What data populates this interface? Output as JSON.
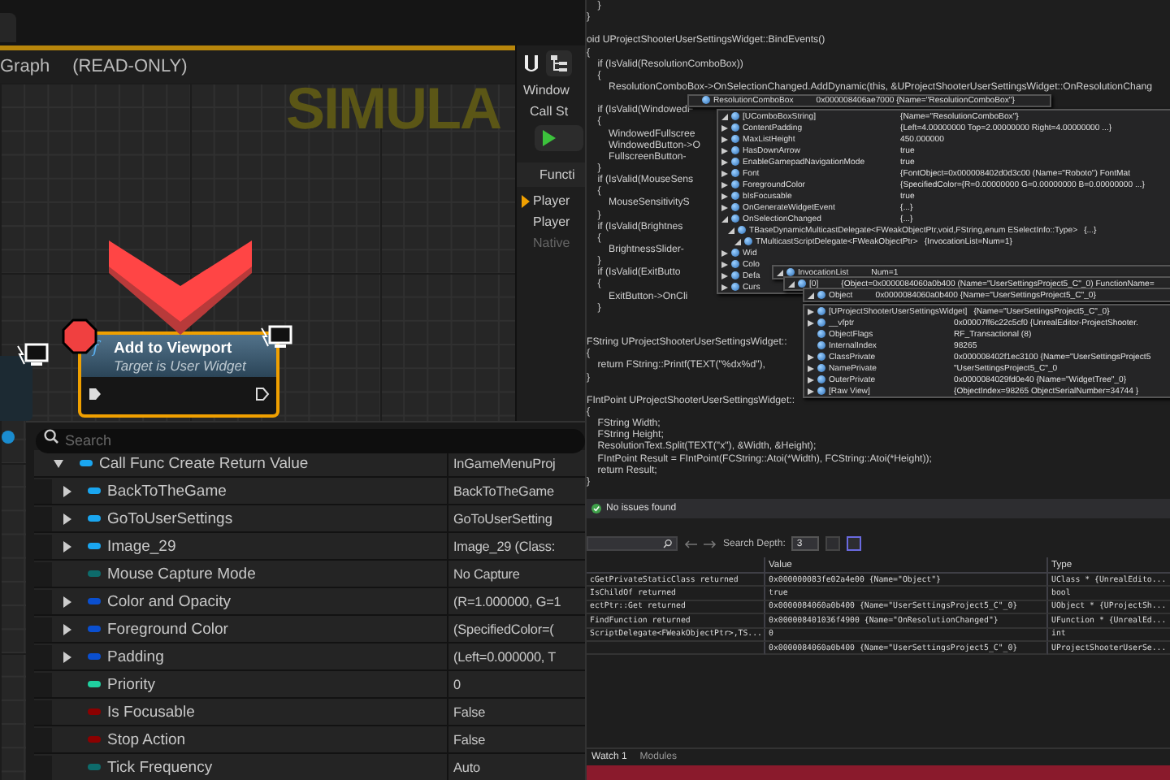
{
  "graph": {
    "title": "Graph",
    "mode": "(READ-ONLY)",
    "overlay_text": "SIMULA",
    "node": {
      "glyph": "f",
      "title": "Add to Viewport",
      "subtitle": "Target is User Widget",
      "breakpoint": true,
      "selected": true
    },
    "debug_panel": {
      "menu": "Window",
      "call_stack_label": "Call St",
      "column_header": "Functi",
      "frames": [
        {
          "label": "Player",
          "current": true,
          "disabled": false
        },
        {
          "label": "Player",
          "current": false,
          "disabled": false
        },
        {
          "label": "Native",
          "current": false,
          "disabled": true
        }
      ]
    },
    "details": {
      "search": {
        "placeholder": "Search"
      },
      "items": [
        {
          "label": "Call Func Create Return Value",
          "value": "InGameMenuProj",
          "color": "#1aa6f0",
          "expanded": true,
          "children": [
            {
              "label": "BackToTheGame",
              "value": "BackToTheGame",
              "color": "#1aa6f0",
              "expanded": false
            },
            {
              "label": "GoToUserSettings",
              "value": "GoToUserSetting",
              "color": "#1aa6f0",
              "expanded": false
            },
            {
              "label": "Image_29",
              "value": "Image_29 (Class:",
              "color": "#1aa6f0",
              "expanded": false
            },
            {
              "label": "Mouse Capture Mode",
              "value": "No Capture",
              "color": "#0d6b6b"
            },
            {
              "label": "Color and Opacity",
              "value": "(R=1.000000, G=1",
              "color": "#0a4fd0",
              "expanded": false
            },
            {
              "label": "Foreground Color",
              "value": "(SpecifiedColor=(",
              "color": "#0a4fd0",
              "expanded": false
            },
            {
              "label": "Padding",
              "value": "(Left=0.000000, T",
              "color": "#0a4fd0",
              "expanded": false
            },
            {
              "label": "Priority",
              "value": "0",
              "color": "#20d0a0"
            },
            {
              "label": "Is Focusable",
              "value": "False",
              "color": "#8c0000"
            },
            {
              "label": "Stop Action",
              "value": "False",
              "color": "#8c0000"
            },
            {
              "label": "Tick Frequency",
              "value": "Auto",
              "color": "#0d6b6b"
            }
          ]
        }
      ]
    }
  },
  "editor": {
    "code_blocks": [
      {
        "lines": [
          "    }",
          "}"
        ]
      },
      {
        "lines": [
          "oid UProjectShooterUserSettingsWidget::BindEvents()",
          "{",
          "    if (IsValid(ResolutionComboBox))",
          "    {",
          "        ResolutionComboBox->OnSelectionChanged.AddDynamic(this, &UProjectShooterUserSettingsWidget::OnResolutionChang"
        ]
      },
      {
        "lines": [
          "    if (IsValid(WindowedF",
          "    {",
          "        WindowedFullscree",
          "        WindowedButton->O",
          "        FullscreenButton-",
          "    }",
          "    if (IsValid(MouseSens",
          "    {",
          "        MouseSensitivityS",
          "    }",
          "    if (IsValid(Brightnes",
          "    {",
          "        BrightnessSlider-",
          "    }",
          "    if (IsValid(ExitButto",
          "    {",
          "        ExitButton->OnCli",
          "    }"
        ]
      },
      {
        "lines": [
          "FString UProjectShooterUserSettingsWidget::",
          "{",
          "    return FString::Printf(TEXT(\"%dx%d\"), ",
          "}"
        ]
      },
      {
        "lines": [
          "FIntPoint UProjectShooterUserSettingsWidget::",
          "{",
          "    FString Width;",
          "    FString Height;",
          "    ResolutionText.Split(TEXT(\"x\"), &Width, &Height);",
          "    FIntPoint Result = FIntPoint(FCString::Atoi(*Width), FCString::Atoi(*Height));",
          "    return Result;",
          "}"
        ]
      }
    ],
    "datatips": [
      {
        "rows": [
          {
            "name": "ResolutionComboBox",
            "value": "0x000008406ae7000 {Name=\"ResolutionComboBox\"}"
          }
        ]
      },
      {
        "rows": [
          {
            "name": "[UComboBoxString]",
            "value": "{Name=\"ResolutionComboBox\"}",
            "expanded": true
          },
          {
            "name": "ContentPadding",
            "value": "{Left=4.00000000 Top=2.00000000 Right=4.00000000 ...}",
            "expanded": false
          },
          {
            "name": "MaxListHeight",
            "value": "450.000000",
            "expanded": false
          },
          {
            "name": "HasDownArrow",
            "value": "true",
            "expanded": false
          },
          {
            "name": "EnableGamepadNavigationMode",
            "value": "true",
            "expanded": false
          },
          {
            "name": "Font",
            "value": "{FontObject=0x000008402d0d3c00 (Name=\"Roboto\") FontMat",
            "expanded": false
          },
          {
            "name": "ForegroundColor",
            "value": "{SpecifiedColor={R=0.00000000 G=0.00000000 B=0.00000000 ...}",
            "expanded": false
          },
          {
            "name": "bIsFocusable",
            "value": "true",
            "expanded": false
          },
          {
            "name": "OnGenerateWidgetEvent",
            "value": "{...}",
            "expanded": false
          },
          {
            "name": "OnSelectionChanged",
            "value": "{...}",
            "expanded": true,
            "children": [
              {
                "name": "TBaseDynamicMulticastDelegate<FWeakObjectPtr,void,FString,enum ESelectInfo::Type>",
                "value": "{...}",
                "expanded": true,
                "children": [
                  {
                    "name": "TMulticastScriptDelegate<FWeakObjectPtr>",
                    "value": "{InvocationList=Num=1}",
                    "expanded": true
                  }
                ]
              }
            ]
          },
          {
            "name": "Wid",
            "expanded": false
          },
          {
            "name": "Colo",
            "expanded": false
          },
          {
            "name": "Defa",
            "expanded": false
          },
          {
            "name": "Curs",
            "expanded": false
          }
        ]
      },
      {
        "rows": [
          {
            "name": "InvocationList",
            "value": "Num=1",
            "expanded": true
          }
        ]
      },
      {
        "rows": [
          {
            "name": "[0]",
            "value": "{Object=0x0000084060a0b400 (Name=\"UserSettingsProject5_C\"_0) FunctionName=",
            "expanded": true
          }
        ]
      },
      {
        "rows": [
          {
            "name": "Object",
            "value": "0x0000084060a0b400 {Name=\"UserSettingsProject5_C\"_0}",
            "expanded": true
          }
        ]
      },
      {
        "rows": [
          {
            "name": "[UProjectShooterUserSettingsWidget]",
            "value": "{Name=\"UserSettingsProject5_C\"_0}",
            "expanded": false
          },
          {
            "name": "__vfptr",
            "value": "0x00007ff6c22c5cf0 {UnrealEditor-ProjectShooter.",
            "expanded": false
          },
          {
            "name": "ObjectFlags",
            "value": "RF_Transactional (8)"
          },
          {
            "name": "InternalIndex",
            "value": "98265"
          },
          {
            "name": "ClassPrivate",
            "value": "0x000008402f1ec3100 {Name=\"UserSettingsProject5",
            "expanded": false
          },
          {
            "name": "NamePrivate",
            "value": "\"UserSettingsProject5_C\"_0",
            "expanded": false
          },
          {
            "name": "OuterPrivate",
            "value": "0x0000084029fd0e40 {Name=\"WidgetTree\"_0}",
            "expanded": false
          },
          {
            "name": "[Raw View]",
            "value": "{ObjectIndex=98265 ObjectSerialNumber=34744 }",
            "expanded": false
          }
        ]
      }
    ],
    "issues": "No issues found",
    "autos": {
      "search_depth_label": "Search Depth:",
      "search_depth": "3",
      "columns": [
        "Value",
        "Type"
      ],
      "rows": [
        {
          "name": "cGetPrivateStaticClass returned",
          "value": "0x000000083fe02a4e00 {Name=\"Object\"}",
          "type": "UClass * {UnrealEdito..."
        },
        {
          "name": "IsChildOf returned",
          "value": "true",
          "type": "bool"
        },
        {
          "name": "ectPtr::Get returned",
          "value": "0x0000084060a0b400 {Name=\"UserSettingsProject5_C\"_0}",
          "type": "UObject * {UProjectSh..."
        },
        {
          "name": "FindFunction returned",
          "value": "0x000008401036f4900 {Name=\"OnResolutionChanged\"}",
          "type": "UFunction * {UnrealEd..."
        },
        {
          "name": "ScriptDelegate<FWeakObjectPtr>,TS...",
          "value": "0",
          "type": "int"
        },
        {
          "value": "0x0000084060a0b400 {Name=\"UserSettingsProject5_C\"_0}",
          "type": "UProjectShooterUserSe..."
        }
      ]
    },
    "bottom_tabs": [
      {
        "label": "Watch 1",
        "selected": true
      },
      {
        "label": "Modules",
        "selected": false
      }
    ]
  }
}
